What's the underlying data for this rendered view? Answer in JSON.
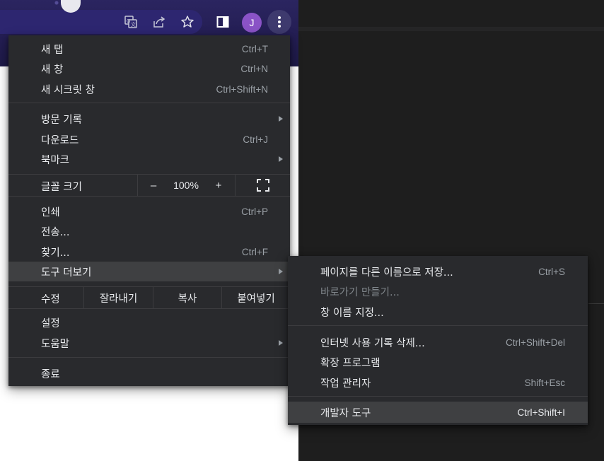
{
  "toolbar": {
    "profile_initial": "J",
    "icons": [
      "translate-icon",
      "share-icon",
      "bookmark-star-icon",
      "side-panel-icon",
      "more-menu-icon"
    ]
  },
  "main_menu": {
    "new_tab": {
      "label": "새 탭",
      "shortcut": "Ctrl+T"
    },
    "new_window": {
      "label": "새 창",
      "shortcut": "Ctrl+N"
    },
    "new_incognito": {
      "label": "새 시크릿 창",
      "shortcut": "Ctrl+Shift+N"
    },
    "history": {
      "label": "방문 기록"
    },
    "downloads": {
      "label": "다운로드",
      "shortcut": "Ctrl+J"
    },
    "bookmarks": {
      "label": "북마크"
    },
    "zoom": {
      "label": "글꼴 크기",
      "minus": "–",
      "value": "100%",
      "plus": "+"
    },
    "print": {
      "label": "인쇄",
      "shortcut": "Ctrl+P"
    },
    "cast": {
      "label": "전송..."
    },
    "find": {
      "label": "찾기...",
      "shortcut": "Ctrl+F"
    },
    "more_tools": {
      "label": "도구 더보기"
    },
    "edit": {
      "label": "수정",
      "cut": "잘라내기",
      "copy": "복사",
      "paste": "붙여넣기"
    },
    "settings": {
      "label": "설정"
    },
    "help": {
      "label": "도움말"
    },
    "exit": {
      "label": "종료"
    }
  },
  "sub_menu": {
    "save_page": {
      "label": "페이지를 다른 이름으로 저장...",
      "shortcut": "Ctrl+S"
    },
    "create_shortcut": {
      "label": "바로가기 만들기..."
    },
    "name_window": {
      "label": "창 이름 지정..."
    },
    "clear_data": {
      "label": "인터넷 사용 기록 삭제...",
      "shortcut": "Ctrl+Shift+Del"
    },
    "extensions": {
      "label": "확장 프로그램"
    },
    "task_manager": {
      "label": "작업 관리자",
      "shortcut": "Shift+Esc"
    },
    "dev_tools": {
      "label": "개발자 도구",
      "shortcut": "Ctrl+Shift+I"
    }
  },
  "colors": {
    "menu_bg": "#292a2d",
    "highlight": "#3f4042",
    "text": "#e8eaed",
    "shortcut": "#9aa0a6",
    "avatar": "#8a53c6"
  }
}
